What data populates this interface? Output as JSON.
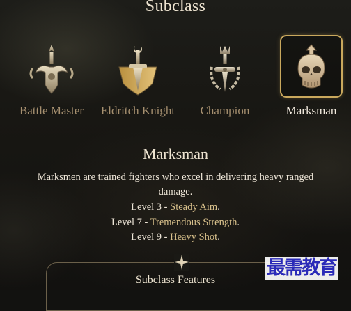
{
  "screen": {
    "heading": "Subclass"
  },
  "subclasses": [
    {
      "name": "Battle Master",
      "icon": "battle-master-emblem-icon",
      "selected": false
    },
    {
      "name": "Eldritch Knight",
      "icon": "eldritch-knight-emblem-icon",
      "selected": false
    },
    {
      "name": "Champion",
      "icon": "champion-emblem-icon",
      "selected": false
    },
    {
      "name": "Marksman",
      "icon": "marksman-skull-emblem-icon",
      "selected": true
    }
  ],
  "details": {
    "title": "Marksman",
    "description": "Marksmen are trained fighters who excel in delivering heavy ranged damage.",
    "levels": [
      {
        "prefix": "Level 3 - ",
        "feature": "Steady Aim",
        "suffix": "."
      },
      {
        "prefix": "Level 7 - ",
        "feature": "Tremendous Strength",
        "suffix": "."
      },
      {
        "prefix": "Level 9 - ",
        "feature": "Heavy Shot",
        "suffix": "."
      }
    ]
  },
  "features_panel": {
    "label": "Subclass Features"
  },
  "watermark": {
    "text": "最需教育"
  },
  "colors": {
    "accent_gold": "#c9a85d",
    "unselected_label": "#a58f6f",
    "selected_label": "#f4ece0",
    "feature_highlight": "#d8c08b",
    "watermark_blue": "#2a2ab8"
  }
}
